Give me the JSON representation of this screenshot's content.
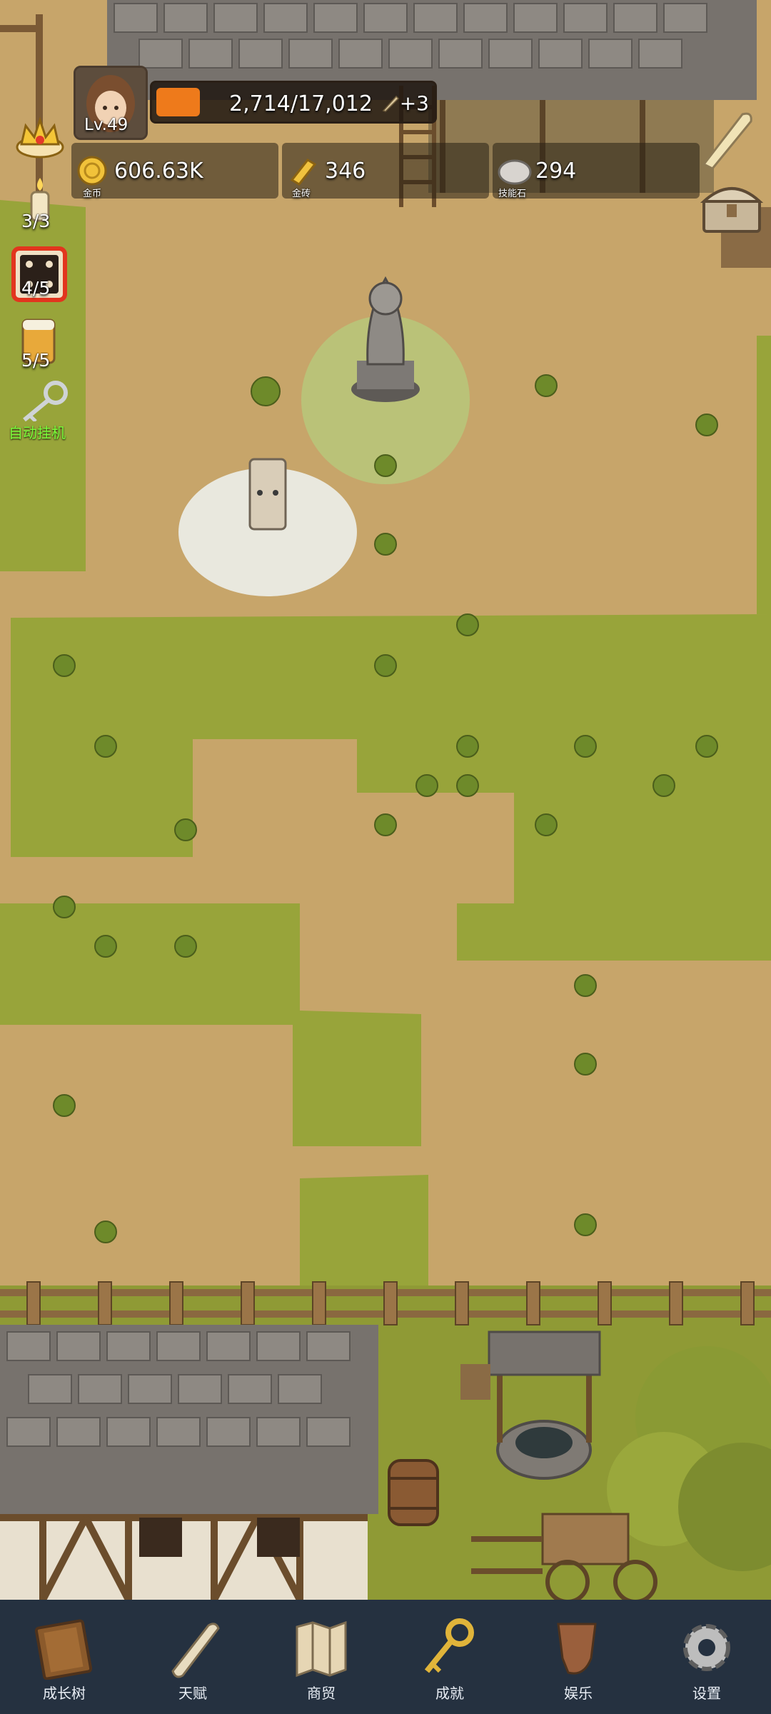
{
  "player": {
    "level": "Lv.49",
    "xp_text": "2,714/17,012",
    "xp_progress": 0.16,
    "xp_bonus": "+3"
  },
  "resources": [
    {
      "id": "gold",
      "value": "606.63K",
      "label": "金币"
    },
    {
      "id": "gold-brick",
      "value": "346",
      "label": "金砖"
    },
    {
      "id": "skill-stone",
      "value": "294",
      "label": "技能石"
    }
  ],
  "side_counters": {
    "candle": "3/3",
    "dice": "4/5",
    "beer": "5/5"
  },
  "auto_idle_label": "自动挂机",
  "nav": [
    {
      "icon": "book-icon",
      "label": "成长树"
    },
    {
      "icon": "scroll-icon",
      "label": "天赋"
    },
    {
      "icon": "map-icon",
      "label": "商贸"
    },
    {
      "icon": "key-icon",
      "label": "成就"
    },
    {
      "icon": "mug-icon",
      "label": "娱乐"
    },
    {
      "icon": "gear-icon",
      "label": "设置"
    }
  ],
  "colors": {
    "xp_fill": "#ee7a1b",
    "nav_bg": "#253140",
    "grass": "#98a43a",
    "dirt": "#c7a56a",
    "auto_idle": "#7cff3a"
  }
}
